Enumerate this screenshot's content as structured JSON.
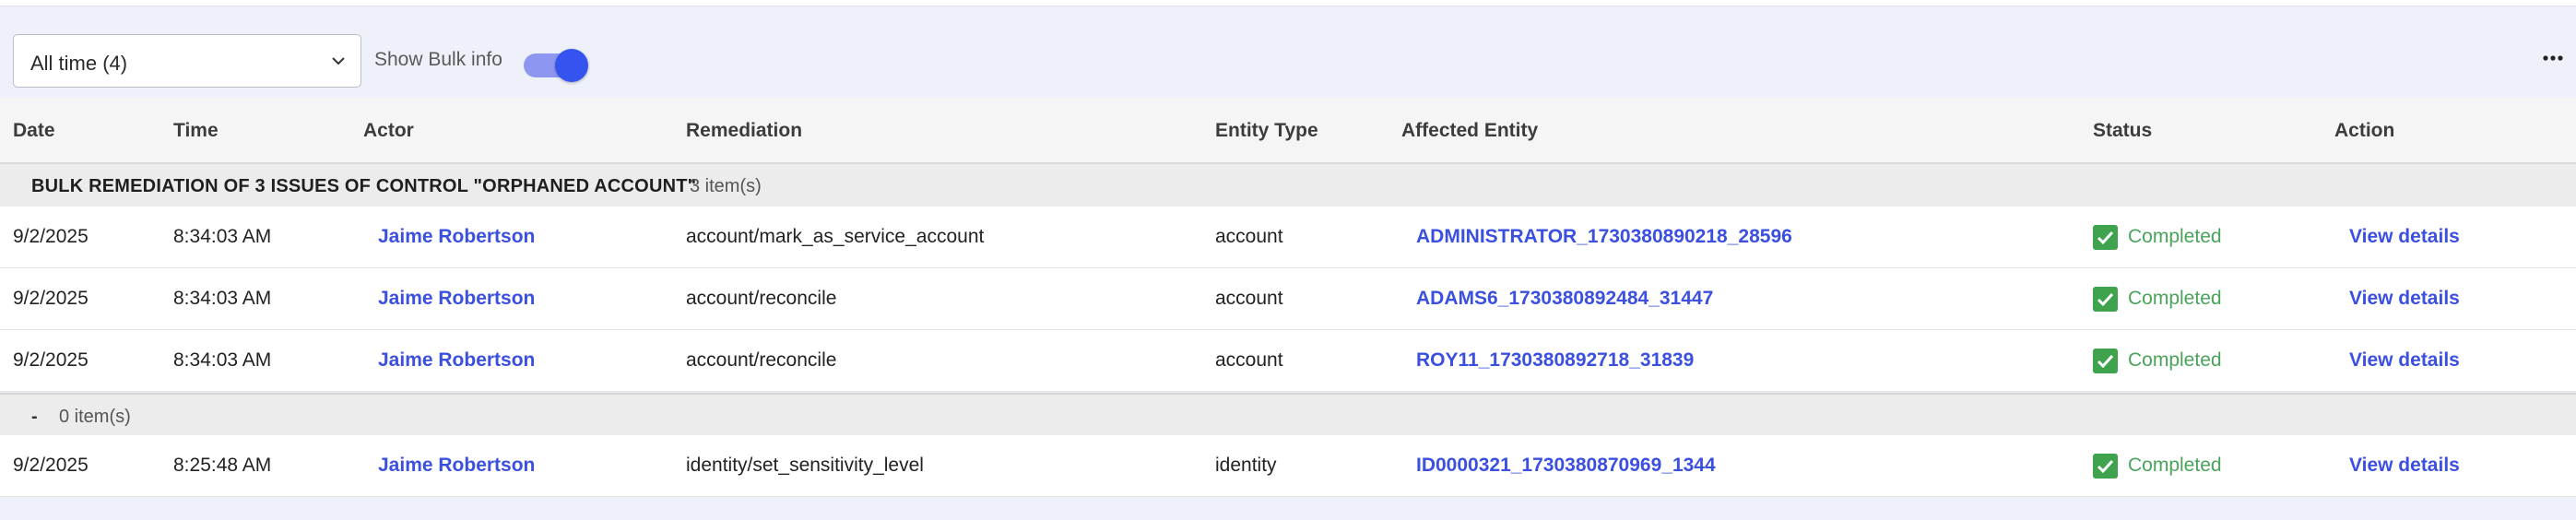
{
  "filter": {
    "value": "All time (4)"
  },
  "bulk_toggle": {
    "label": "Show Bulk info",
    "on": true
  },
  "columns": [
    "Date",
    "Time",
    "Actor",
    "Remediation",
    "Entity Type",
    "Affected Entity",
    "Status",
    "Action"
  ],
  "groups": [
    {
      "title": "BULK REMEDIATION OF 3 ISSUES OF CONTROL \"ORPHANED ACCOUNT\"",
      "count": "3 item(s)",
      "rows": [
        {
          "date": "9/2/2025",
          "time": "8:34:03 AM",
          "actor": "Jaime Robertson",
          "remediation": "account/mark_as_service_account",
          "entity_type": "account",
          "affected_entity": "ADMINISTRATOR_1730380890218_28596",
          "status": "Completed",
          "action": "View details"
        },
        {
          "date": "9/2/2025",
          "time": "8:34:03 AM",
          "actor": "Jaime Robertson",
          "remediation": "account/reconcile",
          "entity_type": "account",
          "affected_entity": "ADAMS6_1730380892484_31447",
          "status": "Completed",
          "action": "View details"
        },
        {
          "date": "9/2/2025",
          "time": "8:34:03 AM",
          "actor": "Jaime Robertson",
          "remediation": "account/reconcile",
          "entity_type": "account",
          "affected_entity": "ROY11_1730380892718_31839",
          "status": "Completed",
          "action": "View details"
        }
      ]
    },
    {
      "title": "-",
      "count": "0 item(s)",
      "rows": [
        {
          "date": "9/2/2025",
          "time": "8:25:48 AM",
          "actor": "Jaime Robertson",
          "remediation": "identity/set_sensitivity_level",
          "entity_type": "identity",
          "affected_entity": "ID0000321_1730380870969_1344",
          "status": "Completed",
          "action": "View details"
        }
      ]
    }
  ],
  "icons": {
    "filter_chevron": "chevron-down-icon",
    "more": "more-horizontal-icon",
    "status": "check-icon"
  },
  "colors": {
    "accent": "#3c50e0",
    "toggle": "#3553ee",
    "success": "#3fa34d",
    "background": "#eef0fa"
  }
}
